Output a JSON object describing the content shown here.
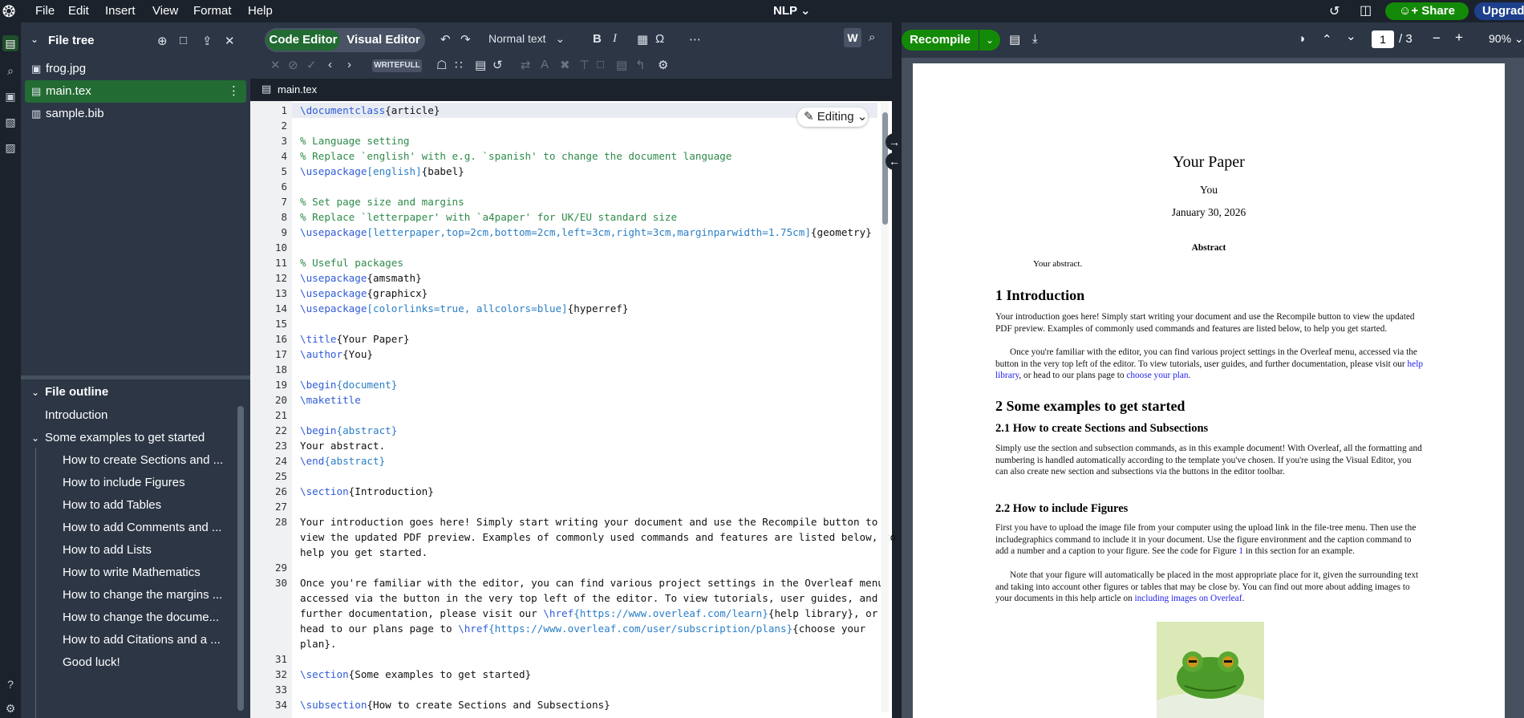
{
  "menu": {
    "file": "File",
    "edit": "Edit",
    "insert": "Insert",
    "view": "View",
    "format": "Format",
    "help": "Help"
  },
  "project": {
    "name": "NLP"
  },
  "actions": {
    "share": "Share",
    "upgrade": "Upgrade"
  },
  "file_tree": {
    "title": "File tree",
    "files": [
      {
        "name": "frog.jpg",
        "icon": "image-icon"
      },
      {
        "name": "main.tex",
        "icon": "file-icon",
        "selected": true
      },
      {
        "name": "sample.bib",
        "icon": "book-icon"
      }
    ]
  },
  "outline": {
    "title": "File outline",
    "items": [
      {
        "label": "Introduction"
      },
      {
        "label": "Some examples to get started"
      },
      {
        "label": "How to create Sections and ..."
      },
      {
        "label": "How to include Figures"
      },
      {
        "label": "How to add Tables"
      },
      {
        "label": "How to add Comments and ..."
      },
      {
        "label": "How to add Lists"
      },
      {
        "label": "How to write Mathematics"
      },
      {
        "label": "How to change the margins ..."
      },
      {
        "label": "How to change the docume..."
      },
      {
        "label": "How to add Citations and a ..."
      },
      {
        "label": "Good luck!"
      }
    ]
  },
  "toolbar": {
    "code_editor": "Code Editor",
    "visual_editor": "Visual Editor",
    "text_style": "Normal text",
    "writefull": "WRITEFULL"
  },
  "tab": {
    "name": "main.tex"
  },
  "editor": {
    "editing_badge": "Editing",
    "line_numbers": [
      "1",
      "2",
      "3",
      "4",
      "5",
      "6",
      "7",
      "8",
      "9",
      "10",
      "11",
      "12",
      "13",
      "14",
      "15",
      "16",
      "17",
      "18",
      "19",
      "20",
      "21",
      "22",
      "23",
      "24",
      "25",
      "26",
      "27",
      "28",
      "29",
      "30",
      "31",
      "32",
      "33",
      "34"
    ],
    "lines": {
      "l1a": "\\documentclass",
      "l1b": "{article}",
      "l3": "% Language setting",
      "l4": "% Replace `english' with e.g. `spanish' to change the document language",
      "l5a": "\\usepackage",
      "l5b": "[english]",
      "l5c": "{babel}",
      "l7": "% Set page size and margins",
      "l8": "% Replace `letterpaper' with `a4paper' for UK/EU standard size",
      "l9a": "\\usepackage",
      "l9b": "[letterpaper,top=2cm,bottom=2cm,left=3cm,right=3cm,marginparwidth=1.75cm]",
      "l9c": "{geometry}",
      "l11": "% Useful packages",
      "l12a": "\\usepackage",
      "l12b": "{amsmath}",
      "l13a": "\\usepackage",
      "l13b": "{graphicx}",
      "l14a": "\\usepackage",
      "l14b": "[colorlinks=true, allcolors=blue]",
      "l14c": "{hyperref}",
      "l16a": "\\title",
      "l16b": "{Your Paper}",
      "l17a": "\\author",
      "l17b": "{You}",
      "l19a": "\\begin",
      "l19b": "{document}",
      "l20a": "\\maketitle",
      "l22a": "\\begin",
      "l22b": "{abstract}",
      "l23": "Your abstract.",
      "l24a": "\\end",
      "l24b": "{abstract}",
      "l26a": "\\section",
      "l26b": "{Introduction}",
      "l28_1": "Your introduction goes here! Simply start writing your document and use the Recompile button to",
      "l28_2": "view the updated PDF preview. Examples of commonly used commands and features are listed below, to",
      "l28_3": "help you get started.",
      "l30_1": "Once you're familiar with the editor, you can find various project settings in the Overleaf menu,",
      "l30_2": "accessed via the button in the very top left of the editor. To view tutorials, user guides, and",
      "l30_3a": "further documentation, please visit our ",
      "l30_3b": "\\href",
      "l30_3c": "{https://www.overleaf.com/learn}",
      "l30_3d": "{help library}, or",
      "l30_4a": "head to our plans page to ",
      "l30_4b": "\\href",
      "l30_4c": "{https://www.overleaf.com/user/subscription/plans}",
      "l30_4d": "{choose your",
      "l30_5": "plan}.",
      "l32a": "\\section",
      "l32b": "{Some examples to get started}",
      "l34a": "\\subsection",
      "l34b": "{How to create Sections and Subsections}"
    }
  },
  "pdf": {
    "recompile": "Recompile",
    "page_current": "1",
    "page_total": "/ 3",
    "zoom": "90%",
    "title": "Your Paper",
    "author": "You",
    "date": "January 30, 2026",
    "abstract_head": "Abstract",
    "abstract_text": "Your abstract.",
    "s1": "1    Introduction",
    "s1_p1": "Your introduction goes here!  Simply start writing your document and use the Recompile button to view the updated PDF preview. Examples of commonly used commands and features are listed below, to help you get started.",
    "s1_p2a": "Once you're familiar with the editor, you can find various project settings in the Overleaf menu, accessed via the button in the very top left of the editor.  To view tutorials, user guides, and further documentation, please visit our ",
    "s1_p2b": "help library",
    "s1_p2c": ", or head to our plans page to ",
    "s1_p2d": "choose your plan",
    "s1_p2e": ".",
    "s2": "2    Some examples to get started",
    "s21": "2.1    How to create Sections and Subsections",
    "s21_p": "Simply use the section and subsection commands, as in this example document! With Overleaf, all the formatting and numbering is handled automatically according to the template you've chosen.  If you're using the Visual Editor, you can also create new section and subsections via the buttons in the editor toolbar.",
    "s22": "2.2    How to include Figures",
    "s22_p1a": "First you have to upload the image file from your computer using the upload link in the file-tree menu. Then use the includegraphics command to include it in your document.  Use the figure environment and the caption command to add a number and a caption to your figure.  See the code for Figure ",
    "s22_p1b": "1",
    "s22_p1c": " in this section for an example.",
    "s22_p2a": "Note that your figure will automatically be placed in the most appropriate place for it, given the surrounding text and taking into account other figures or tables that may be close by.  You can find out more about adding images to your documents in this help article on ",
    "s22_p2b": "including images on Overleaf",
    "s22_p2c": "."
  },
  "colors": {
    "accent_green": "#138a07",
    "bg_dark": "#1b222c",
    "panel": "#2c3645",
    "link": "#2222ee"
  }
}
